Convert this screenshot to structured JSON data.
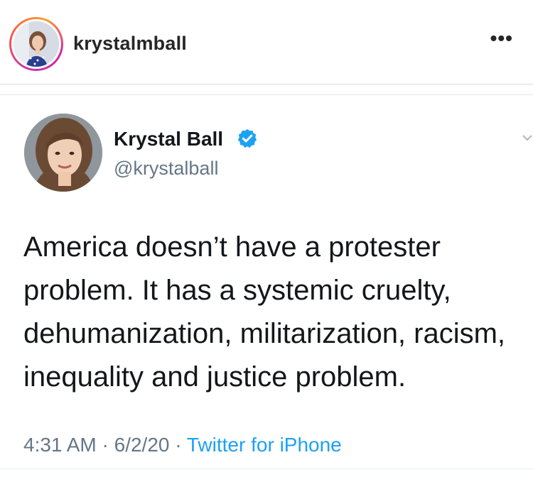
{
  "instagram_post": {
    "username": "krystalmball",
    "more_icon": "more-dots-icon",
    "more_label": "•••"
  },
  "tweet": {
    "name": "Krystal Ball",
    "verified_icon": "verified-badge-icon",
    "handle": "@krystalball",
    "text_lines": [
      "America doesn’t have a protester",
      "problem. It has a systemic cruelty,",
      "dehumanization, militarization, racism,",
      "inequality and justice problem."
    ],
    "time": "4:31 AM",
    "separator": " · ",
    "date": "6/2/20",
    "source": "Twitter for iPhone"
  },
  "colors": {
    "verified": "#1da1f2",
    "link": "#1da1f2",
    "secondary_text": "#657786",
    "text": "#14171a"
  }
}
